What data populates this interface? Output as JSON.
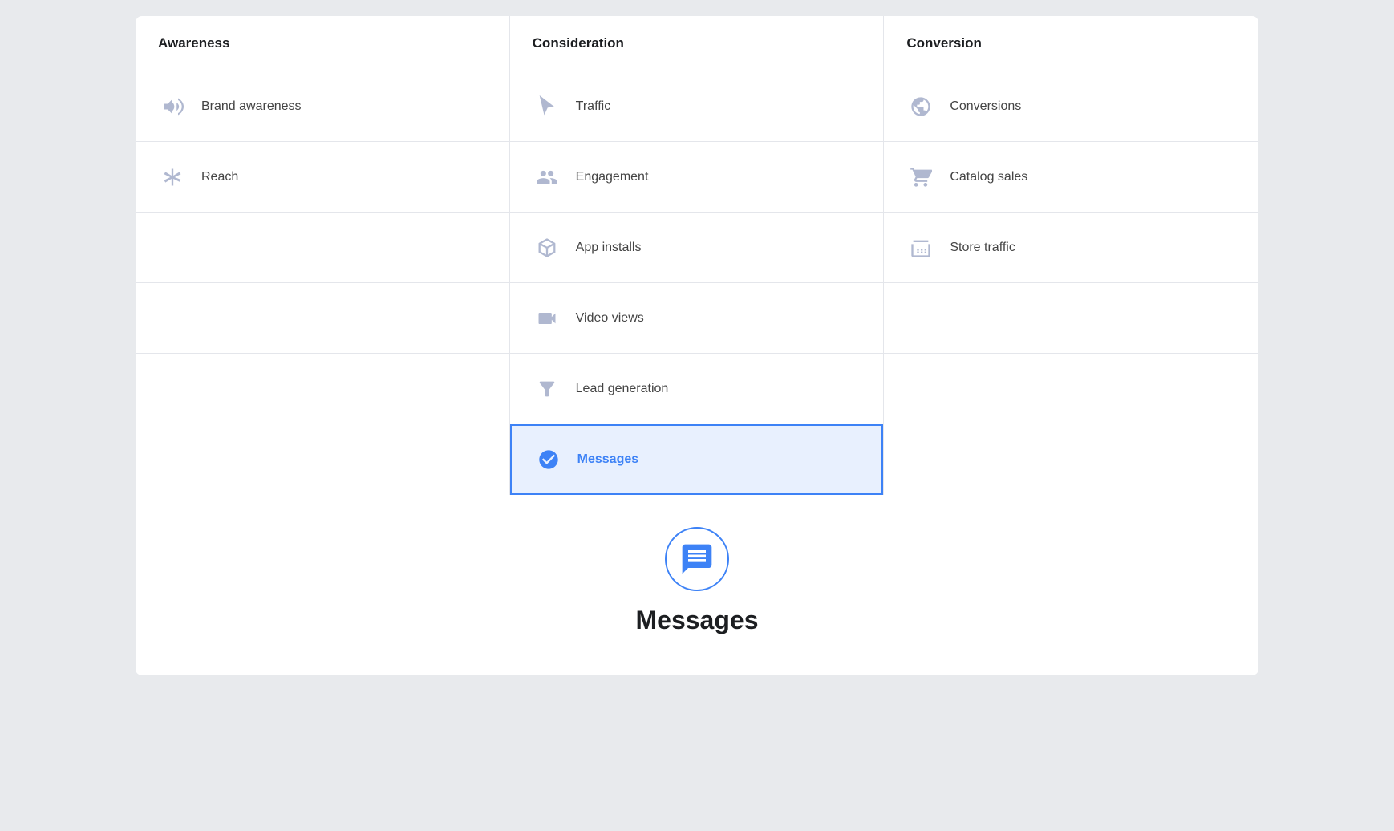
{
  "columns": [
    {
      "id": "awareness",
      "header": "Awareness",
      "items": [
        {
          "id": "brand-awareness",
          "label": "Brand awareness",
          "icon": "megaphone"
        },
        {
          "id": "reach",
          "label": "Reach",
          "icon": "asterisk"
        }
      ]
    },
    {
      "id": "consideration",
      "header": "Consideration",
      "items": [
        {
          "id": "traffic",
          "label": "Traffic",
          "icon": "cursor"
        },
        {
          "id": "engagement",
          "label": "Engagement",
          "icon": "people"
        },
        {
          "id": "app-installs",
          "label": "App installs",
          "icon": "cube"
        },
        {
          "id": "video-views",
          "label": "Video views",
          "icon": "video"
        },
        {
          "id": "lead-generation",
          "label": "Lead generation",
          "icon": "filter"
        },
        {
          "id": "messages",
          "label": "Messages",
          "icon": "messages",
          "selected": true
        }
      ]
    },
    {
      "id": "conversion",
      "header": "Conversion",
      "items": [
        {
          "id": "conversions",
          "label": "Conversions",
          "icon": "globe"
        },
        {
          "id": "catalog-sales",
          "label": "Catalog sales",
          "icon": "cart"
        },
        {
          "id": "store-traffic",
          "label": "Store traffic",
          "icon": "store"
        }
      ]
    }
  ],
  "selected": {
    "id": "messages",
    "label": "Messages"
  }
}
